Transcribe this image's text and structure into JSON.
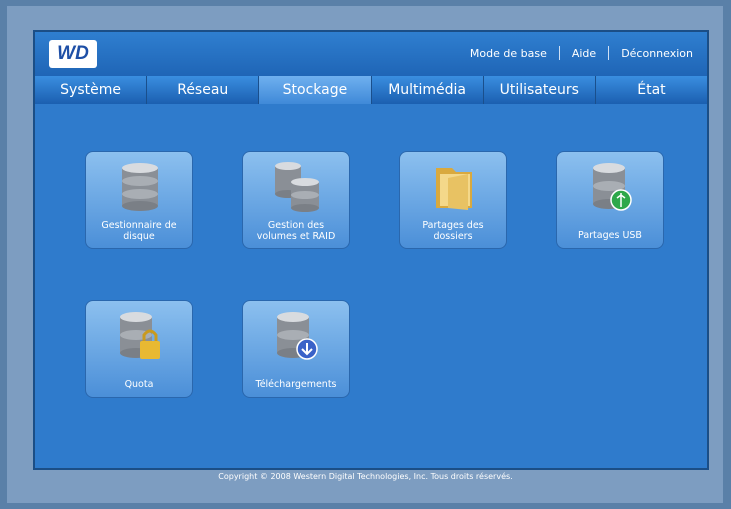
{
  "brand": {
    "logo_text": "WD"
  },
  "header_links": [
    "Mode de base",
    "Aide",
    "Déconnexion"
  ],
  "tabs": [
    {
      "label": "Système",
      "active": false
    },
    {
      "label": "Réseau",
      "active": false
    },
    {
      "label": "Stockage",
      "active": true
    },
    {
      "label": "Multimédia",
      "active": false
    },
    {
      "label": "Utilisateurs",
      "active": false
    },
    {
      "label": "État",
      "active": false
    }
  ],
  "tiles": [
    {
      "label": "Gestionnaire de disque",
      "icon": "disk-stack-icon"
    },
    {
      "label": "Gestion des volumes et RAID",
      "icon": "raid-volumes-icon"
    },
    {
      "label": "Partages des dossiers",
      "icon": "folder-share-icon"
    },
    {
      "label": "Partages USB",
      "icon": "usb-share-icon"
    },
    {
      "label": "Quota",
      "icon": "quota-lock-icon"
    },
    {
      "label": "Téléchargements",
      "icon": "download-icon"
    }
  ],
  "footer": "Copyright © 2008 Western Digital Technologies, Inc. Tous droits réservés.",
  "colors": {
    "background": "#2f7bcc",
    "tile": "#4b8fd8",
    "active_tab": "#6fb0ef"
  }
}
